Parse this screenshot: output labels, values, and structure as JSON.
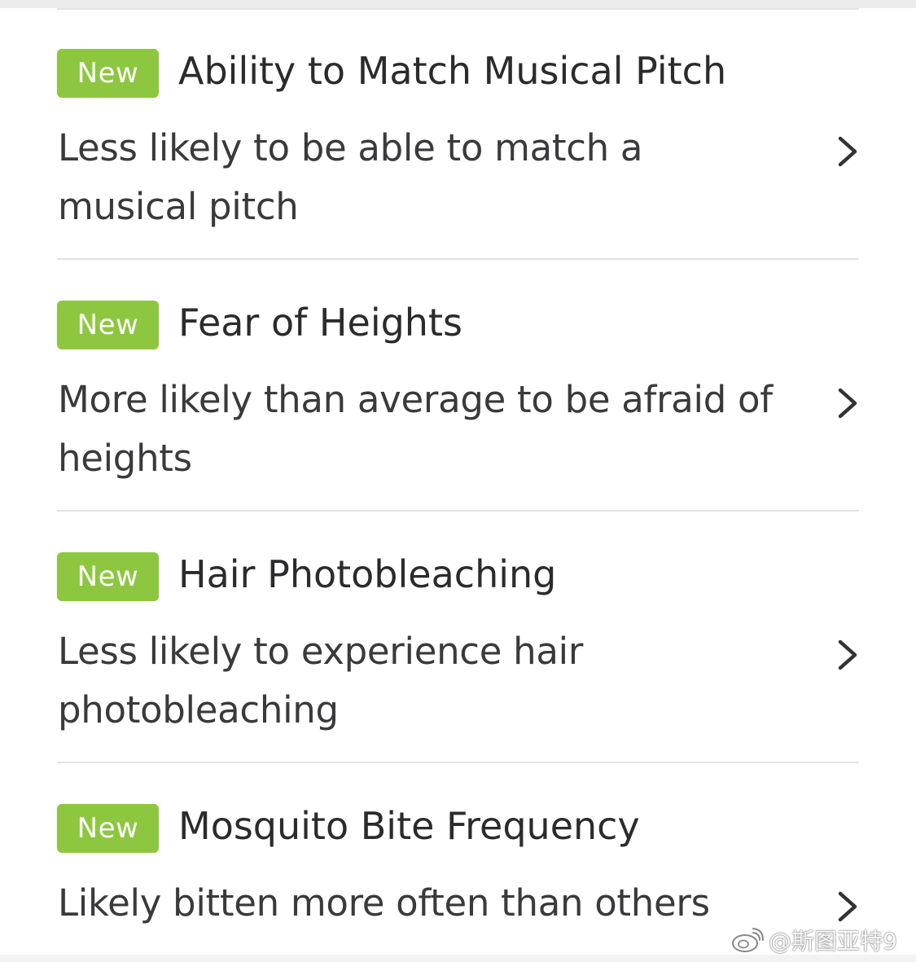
{
  "colors": {
    "badge_bg": "#8dc73f",
    "title_text": "#2b2b2d",
    "desc_text": "#3a3a3d",
    "divider": "#e3e3e6",
    "chevron": "#333333"
  },
  "items": [
    {
      "badge": "New",
      "title": "Ability to Match Musical Pitch",
      "description": "Less likely to be able to match a musical pitch",
      "chevron_icon": "chevron-right-icon"
    },
    {
      "badge": "New",
      "title": "Fear of Heights",
      "description": "More likely than average to be afraid of heights",
      "chevron_icon": "chevron-right-icon"
    },
    {
      "badge": "New",
      "title": "Hair Photobleaching",
      "description": "Less likely to experience hair photobleaching",
      "chevron_icon": "chevron-right-icon"
    },
    {
      "badge": "New",
      "title": "Mosquito Bite Frequency",
      "description": "Likely bitten more often than others",
      "chevron_icon": "chevron-right-icon"
    }
  ],
  "watermark": {
    "icon": "weibo-icon",
    "text": "@斯图亚特9"
  }
}
